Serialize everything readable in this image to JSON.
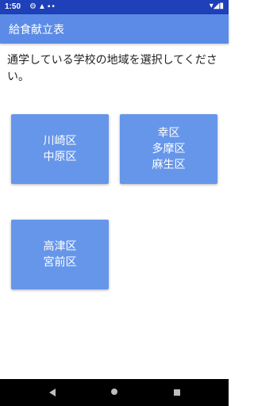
{
  "status_bar": {
    "time": "1:50",
    "left_icons": [
      "gear-icon",
      "sim-alert-icon",
      "sd-card-icon",
      "dot-icon"
    ],
    "right_icons": [
      "wifi-icon",
      "signal-icon",
      "battery-icon"
    ]
  },
  "app_bar": {
    "title": "給食献立表"
  },
  "instruction": "通学している学校の地域を選択してください。",
  "districts": [
    {
      "lines": [
        "川崎区",
        "中原区"
      ]
    },
    {
      "lines": [
        "幸区",
        "多摩区",
        "麻生区"
      ]
    },
    {
      "lines": [
        "高津区",
        "宮前区"
      ]
    }
  ],
  "colors": {
    "status_bar": "#1e40b8",
    "app_bar": "#5b8be6",
    "button": "#6696ea",
    "nav_bar": "#000000"
  }
}
